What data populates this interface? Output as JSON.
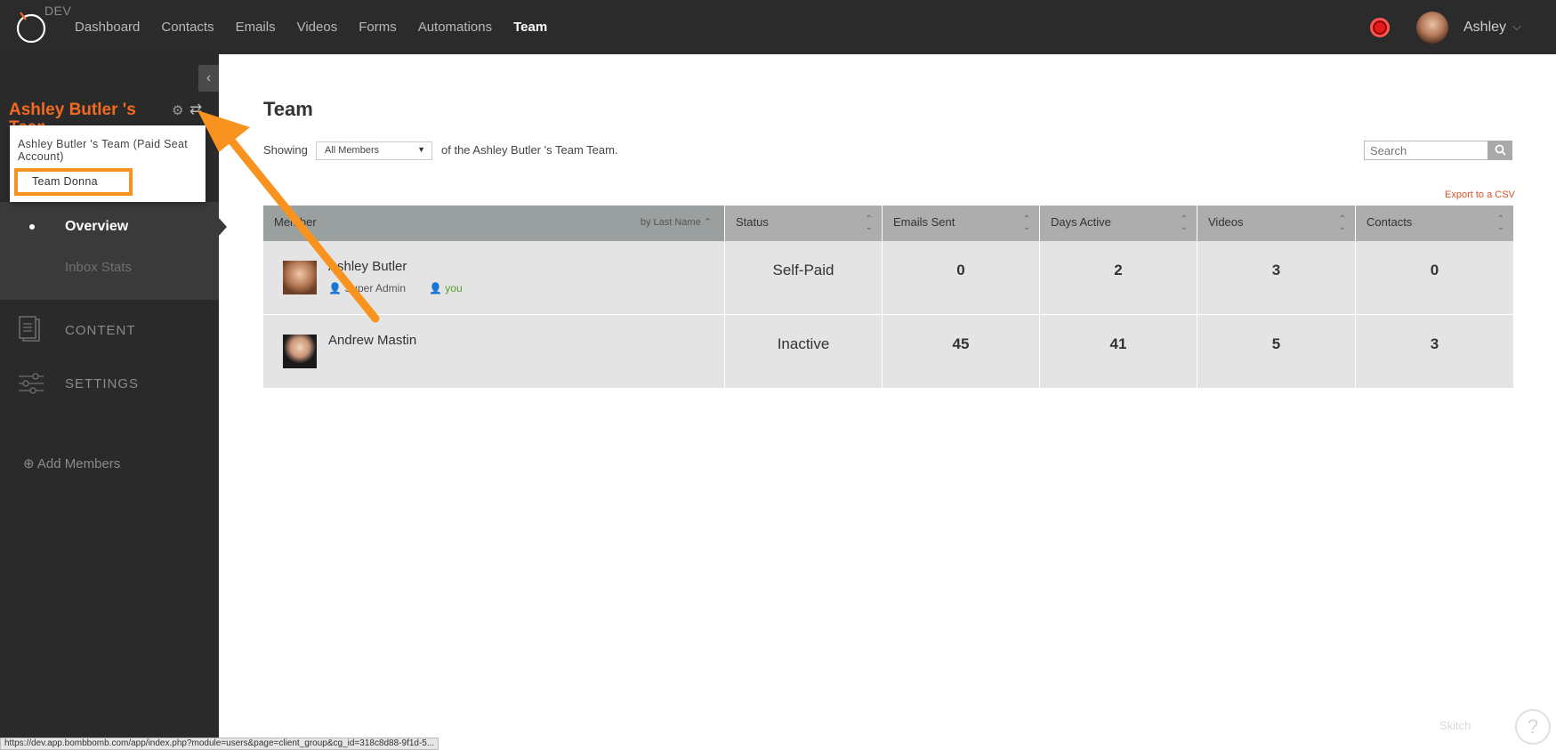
{
  "topbar": {
    "env": "DEV",
    "nav": [
      "Dashboard",
      "Contacts",
      "Emails",
      "Videos",
      "Forms",
      "Automations",
      "Team"
    ],
    "active_nav": "Team",
    "user_name": "Ashley",
    "chevron": "⌵"
  },
  "sidebar": {
    "team_title": "Ashley Butler 's",
    "team_title_2": "Team",
    "dropdown": {
      "item1": "Ashley Butler 's Team (Paid Seat Account)",
      "item2": "Team Donna"
    },
    "menu": {
      "overview": "Overview",
      "inbox_stats": "Inbox Stats",
      "content": "CONTENT",
      "settings": "SETTINGS",
      "add_members": "Add Members"
    }
  },
  "main": {
    "title": "Team",
    "showing_prefix": "Showing",
    "select_value": "All Members",
    "showing_suffix": "of the Ashley Butler 's Team Team.",
    "search_placeholder": "Search",
    "export": "Export to a CSV",
    "columns": {
      "member": "Member",
      "by_last_name": "by Last Name",
      "status": "Status",
      "emails": "Emails Sent",
      "days": "Days Active",
      "videos": "Videos",
      "contacts": "Contacts"
    },
    "rows": [
      {
        "name": "Ashley Butler",
        "role": "Super Admin",
        "you": "you",
        "status": "Self-Paid",
        "emails": "0",
        "days": "2",
        "videos": "3",
        "contacts": "0"
      },
      {
        "name": "Andrew Mastin",
        "status": "Inactive",
        "emails": "45",
        "days": "41",
        "videos": "5",
        "contacts": "3"
      }
    ]
  },
  "statusbar": {
    "url": "https://dev.app.bombbomb.com/app/index.php?module=users&page=client_group&cg_id=318c8d88-9f1d-5..."
  },
  "overlay": {
    "skitch": "Skitch",
    "help": "?"
  },
  "colors": {
    "accent": "#f26a21",
    "annotation": "#f7931e",
    "record": "#e51b1b"
  }
}
